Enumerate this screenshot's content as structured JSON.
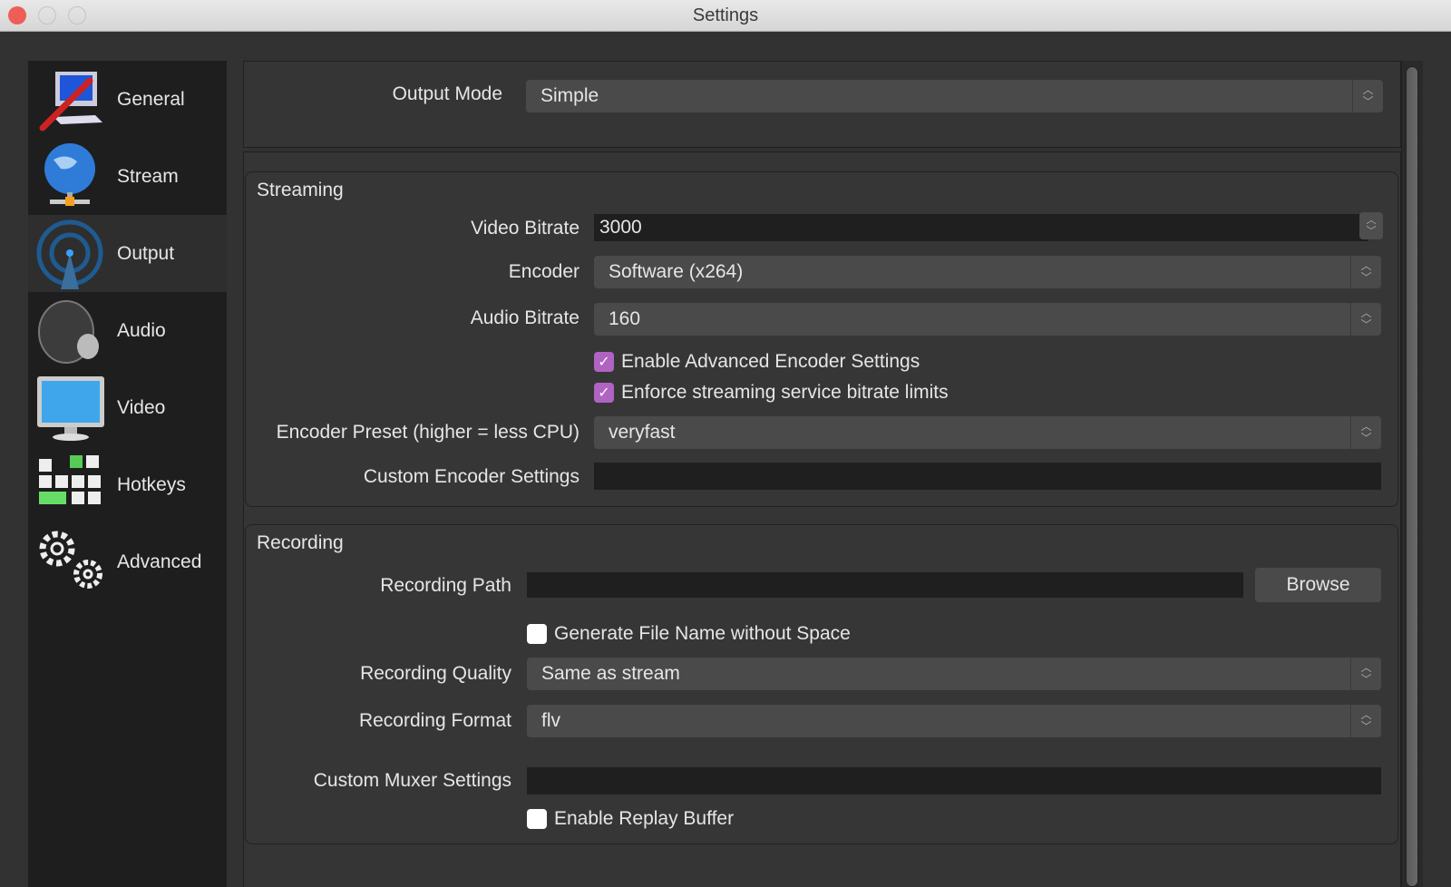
{
  "window": {
    "title": "Settings"
  },
  "sidebar": {
    "items": [
      {
        "label": "General",
        "icon": "general-icon"
      },
      {
        "label": "Stream",
        "icon": "globe-icon"
      },
      {
        "label": "Output",
        "icon": "broadcast-icon",
        "selected": true
      },
      {
        "label": "Audio",
        "icon": "speaker-icon"
      },
      {
        "label": "Video",
        "icon": "monitor-icon"
      },
      {
        "label": "Hotkeys",
        "icon": "keyboard-icon"
      },
      {
        "label": "Advanced",
        "icon": "gears-icon"
      }
    ]
  },
  "output_mode": {
    "label": "Output Mode",
    "value": "Simple"
  },
  "streaming": {
    "title": "Streaming",
    "video_bitrate_label": "Video Bitrate",
    "video_bitrate": "3000",
    "encoder_label": "Encoder",
    "encoder": "Software (x264)",
    "audio_bitrate_label": "Audio Bitrate",
    "audio_bitrate": "160",
    "adv_encoder": {
      "label": "Enable Advanced Encoder Settings",
      "checked": true
    },
    "enforce": {
      "label": "Enforce streaming service bitrate limits",
      "checked": true
    },
    "preset_label": "Encoder Preset (higher = less CPU)",
    "preset": "veryfast",
    "custom_label": "Custom Encoder Settings",
    "custom": ""
  },
  "recording": {
    "title": "Recording",
    "path_label": "Recording Path",
    "path": "",
    "browse": "Browse",
    "no_space": {
      "label": "Generate File Name without Space",
      "checked": false
    },
    "quality_label": "Recording Quality",
    "quality": "Same as stream",
    "format_label": "Recording Format",
    "format": "flv",
    "muxer_label": "Custom Muxer Settings",
    "muxer": "",
    "replay": {
      "label": "Enable Replay Buffer",
      "checked": false
    }
  },
  "colors": {
    "accent_checkbox": "#b063c2",
    "close": "#ee5e57"
  }
}
